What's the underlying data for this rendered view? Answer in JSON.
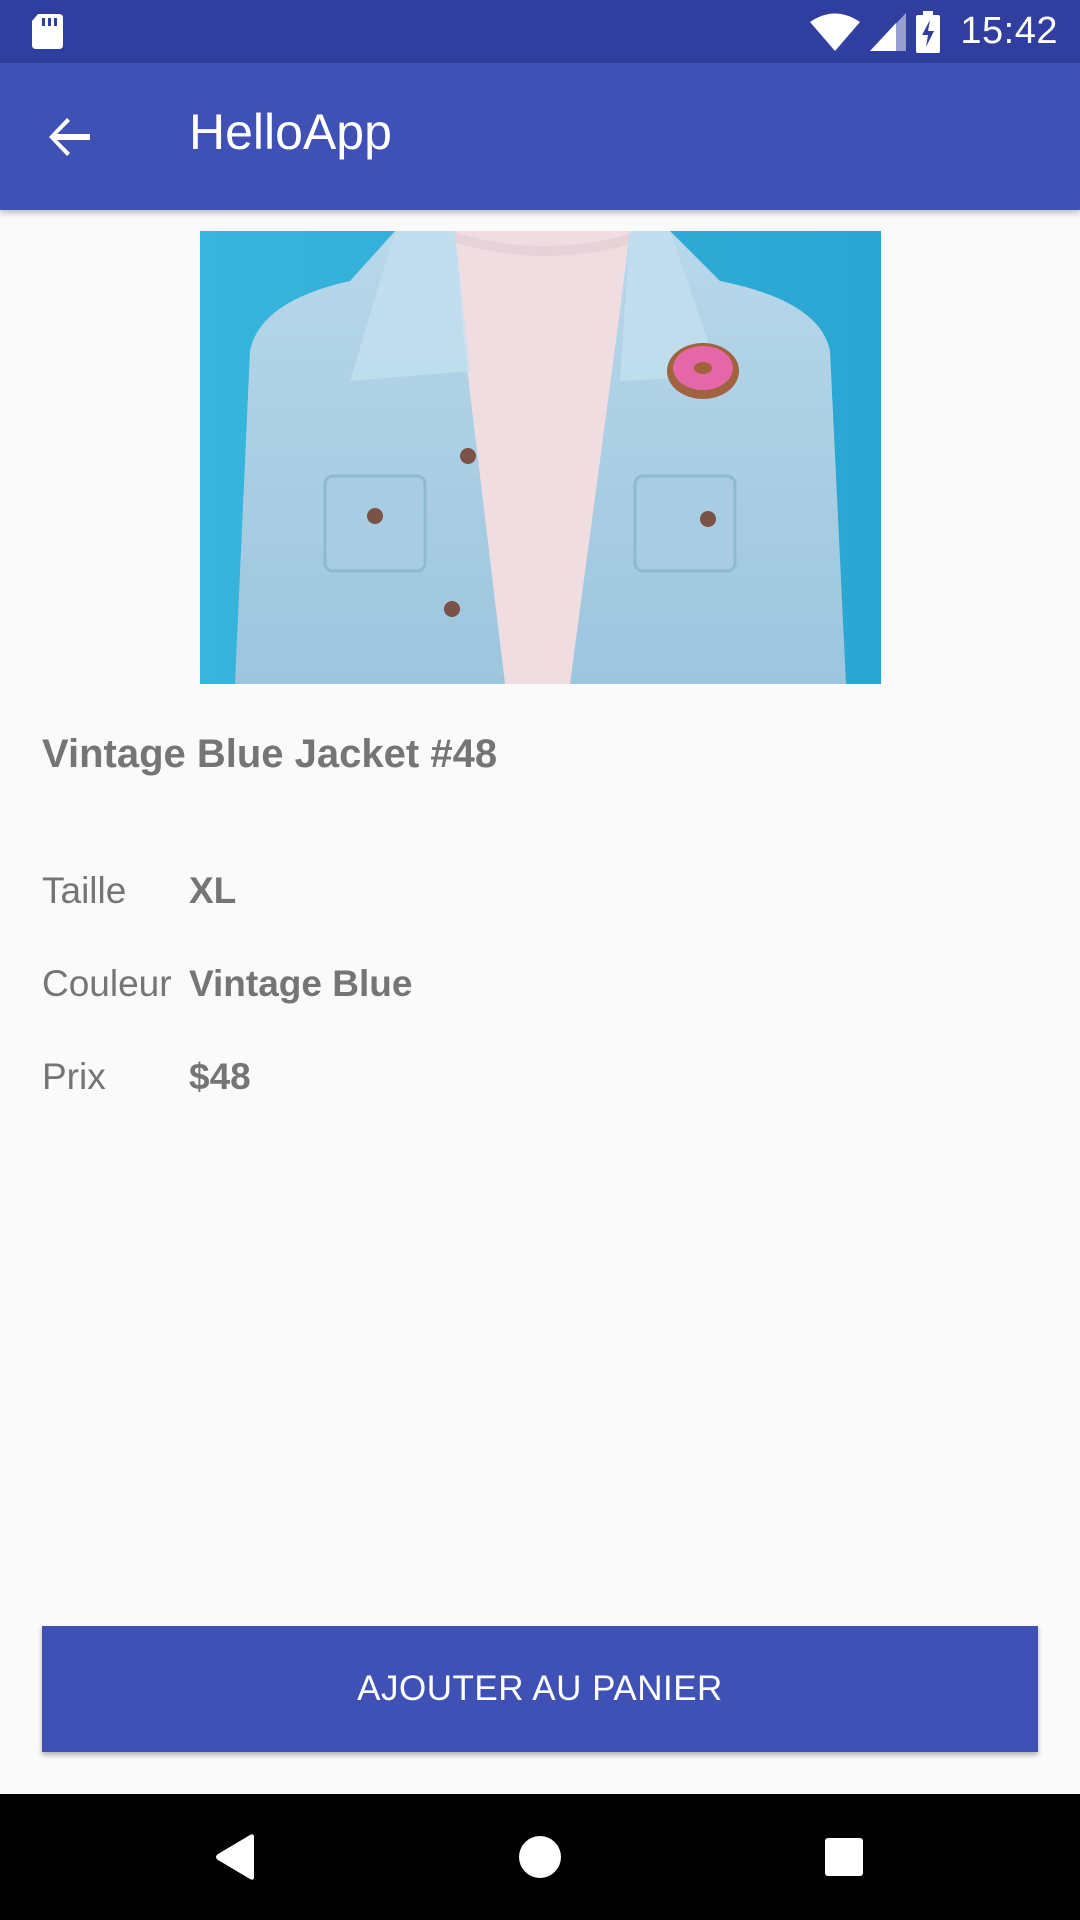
{
  "status_bar": {
    "time": "15:42",
    "icons": [
      "sd-card-icon",
      "wifi-icon",
      "signal-icon",
      "battery-charging-icon"
    ],
    "background": "#303f9f"
  },
  "app_bar": {
    "title": "HelloApp",
    "back_icon": "arrow-back-icon",
    "background": "#3f51b5"
  },
  "product": {
    "image_alt": "product-photo",
    "title": "Vintage Blue Jacket #48",
    "details": [
      {
        "label": "Taille",
        "value": "XL"
      },
      {
        "label": "Couleur",
        "value": "Vintage Blue"
      },
      {
        "label": "Prix",
        "value": "$48"
      }
    ]
  },
  "actions": {
    "add_to_cart_label": "AJOUTER AU PANIER",
    "accent": "#3f51b5"
  },
  "nav_bar": {
    "icons": [
      "back-triangle-icon",
      "home-circle-icon",
      "recents-square-icon"
    ]
  }
}
